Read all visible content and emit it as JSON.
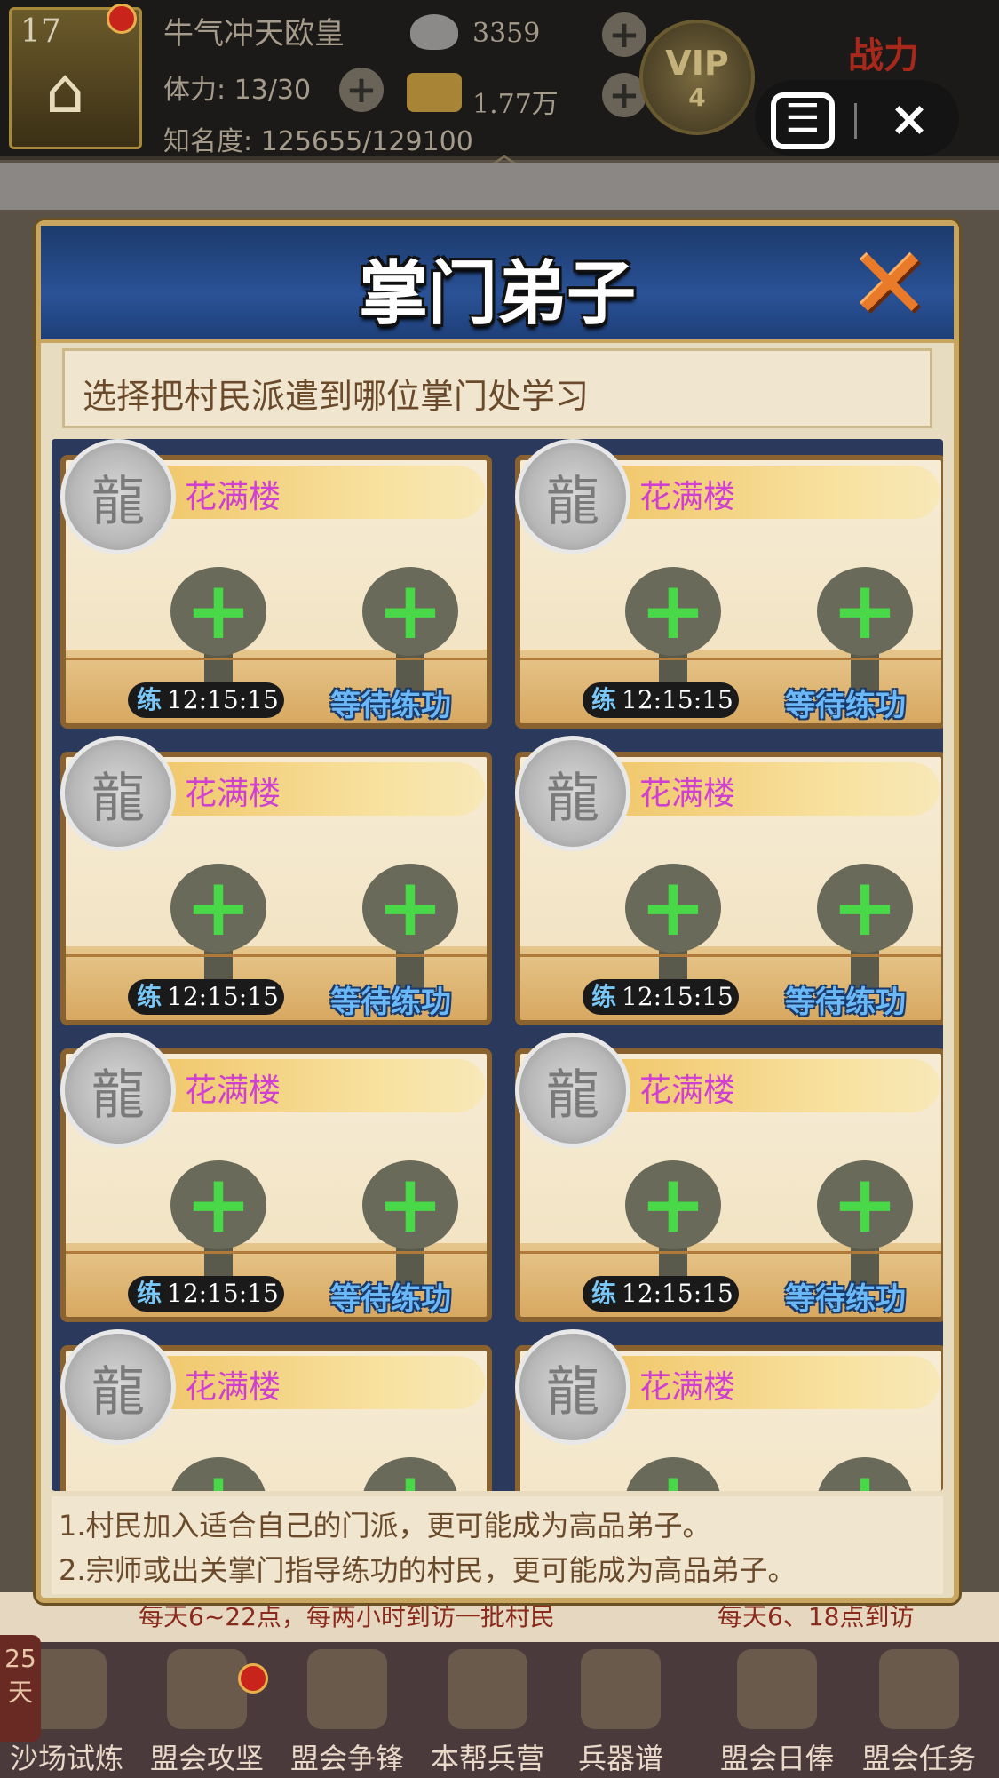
{
  "topbar": {
    "level": "17",
    "player_name": "牛气冲天欧皇",
    "stamina": "体力: 13/30",
    "fame": "知名度: 125655/129100",
    "ingot": "3359",
    "gold": "1.77万",
    "vip_label": "VIP",
    "vip_level": "4",
    "power_label": "战力",
    "capsule_menu_icon": "menu-icon",
    "capsule_close_icon": "close-icon"
  },
  "dialog": {
    "title": "掌门弟子",
    "instruction": "选择把村民派遣到哪位掌门处学习",
    "cards": [
      {
        "name": "花满楼",
        "timer_label": "练",
        "timer": "12:15:15",
        "status": "等待练功"
      },
      {
        "name": "花满楼",
        "timer_label": "练",
        "timer": "12:15:15",
        "status": "等待练功"
      },
      {
        "name": "花满楼",
        "timer_label": "练",
        "timer": "12:15:15",
        "status": "等待练功"
      },
      {
        "name": "花满楼",
        "timer_label": "练",
        "timer": "12:15:15",
        "status": "等待练功"
      },
      {
        "name": "花满楼",
        "timer_label": "练",
        "timer": "12:15:15",
        "status": "等待练功"
      },
      {
        "name": "花满楼",
        "timer_label": "练",
        "timer": "12:15:15",
        "status": "等待练功"
      },
      {
        "name": "花满楼"
      },
      {
        "name": "花满楼"
      }
    ],
    "notes": [
      "1.村民加入适合自己的门派，更可能成为高品弟子。",
      "2.宗师或出关掌门指导练功的村民，更可能成为高品弟子。"
    ]
  },
  "behind": {
    "left": "每天6~22点，每两小时到访一批村民",
    "right": "每天6、18点到访"
  },
  "bottom_nav": {
    "days": "25天",
    "items": [
      "沙场试炼",
      "盟会攻坚",
      "盟会争锋",
      "本帮兵营",
      "兵器谱",
      "盟会日俸",
      "盟会任务"
    ]
  },
  "colors": {
    "accent_gold": "#c8a660",
    "header_blue": "#2a5296",
    "name_pink": "#d040d0",
    "plus_green": "#48d848",
    "status_blue": "#6ab8f8"
  }
}
